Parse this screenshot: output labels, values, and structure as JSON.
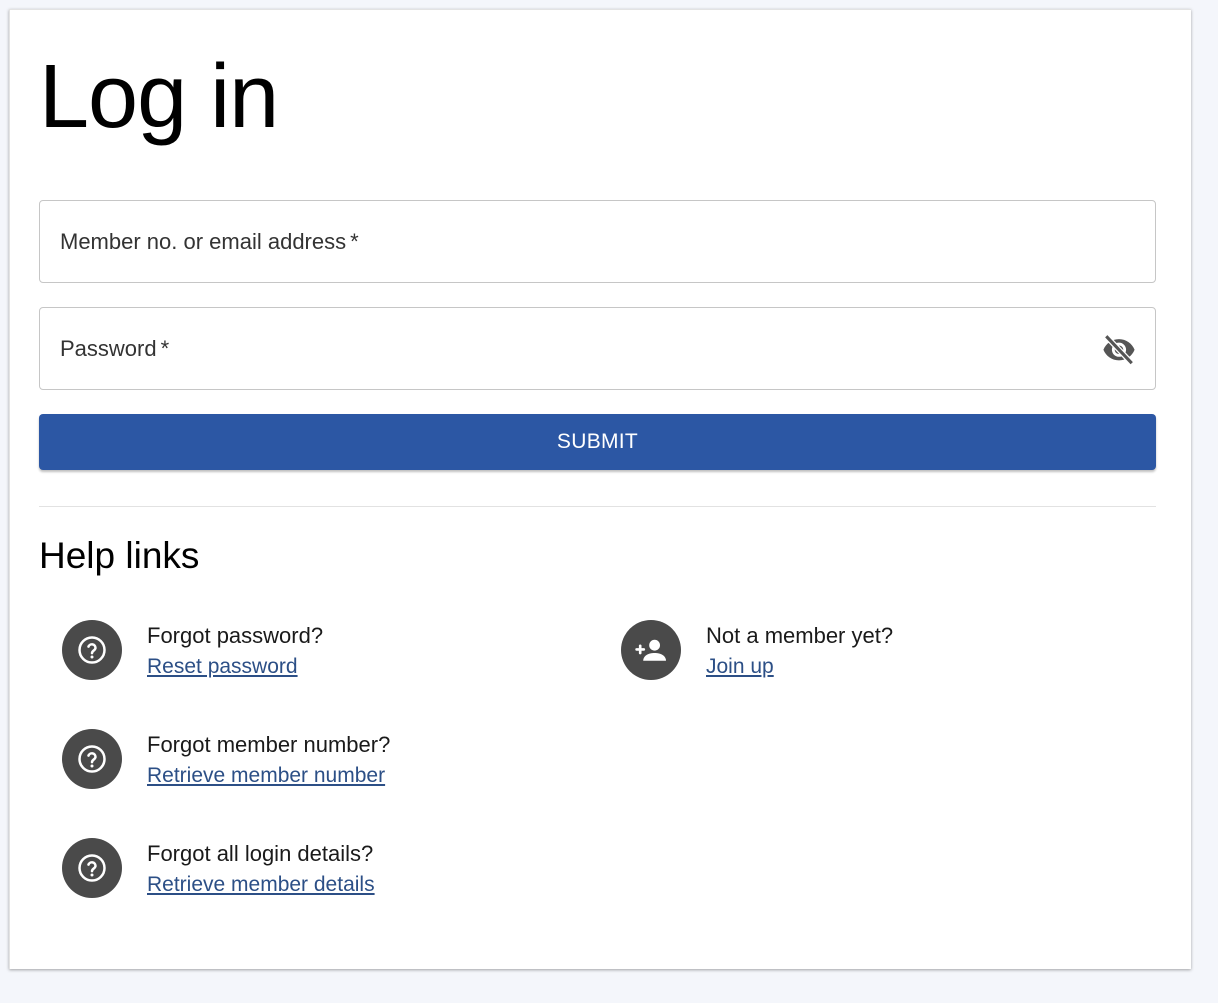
{
  "page": {
    "title": "Log in"
  },
  "form": {
    "email": {
      "label": "Member no. or email address",
      "required_marker": "*",
      "value": ""
    },
    "password": {
      "label": "Password",
      "required_marker": "*",
      "value": "",
      "toggle_icon": "visibility-off-icon"
    },
    "submit_label": "SUBMIT"
  },
  "help": {
    "title": "Help links",
    "items": [
      {
        "question": "Forgot password?",
        "link": "Reset password",
        "icon": "help-circle-icon"
      },
      {
        "question": "Forgot member number?",
        "link": "Retrieve member number",
        "icon": "help-circle-icon"
      },
      {
        "question": "Forgot all login details?",
        "link": "Retrieve member details",
        "icon": "help-circle-icon"
      },
      {
        "question": "Not a member yet?",
        "link": "Join up",
        "icon": "add-user-icon"
      }
    ]
  },
  "colors": {
    "primary": "#2c57a4",
    "link": "#2c4f86",
    "icon_bg": "#4a4a4a",
    "page_bg": "#f4f6fb"
  }
}
